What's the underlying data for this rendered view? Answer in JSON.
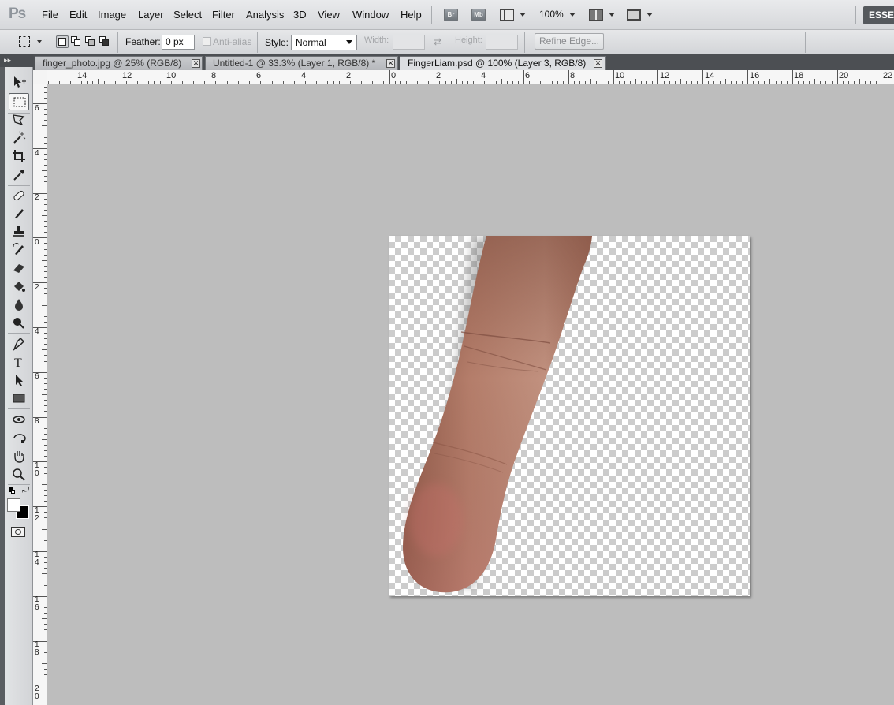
{
  "app": {
    "logo": "Ps",
    "workspace": "ESSENTIALS"
  },
  "menu": [
    "File",
    "Edit",
    "Image",
    "Layer",
    "Select",
    "Filter",
    "Analysis",
    "3D",
    "View",
    "Window",
    "Help"
  ],
  "appbar": {
    "bridge": "Br",
    "minibridge": "Mb",
    "zoom": "100%"
  },
  "options": {
    "feather_label": "Feather:",
    "feather_value": "0 px",
    "antialias_label": "Anti-alias",
    "style_label": "Style:",
    "style_value": "Normal",
    "width_label": "Width:",
    "height_label": "Height:",
    "refine_label": "Refine Edge..."
  },
  "tabs": [
    {
      "label": "finger_photo.jpg @ 25% (RGB/8)",
      "active": false
    },
    {
      "label": "Untitled-1 @ 33.3% (Layer 1, RGB/8) *",
      "active": false
    },
    {
      "label": "FingerLiam.psd @ 100% (Layer 3, RGB/8)",
      "active": true
    }
  ],
  "ruler_top": [
    "14",
    "12",
    "10",
    "8",
    "6",
    "4",
    "2",
    "0",
    "2",
    "4",
    "6",
    "8",
    "10",
    "12",
    "14",
    "16",
    "18",
    "20",
    "22"
  ],
  "ruler_left": [
    "6",
    "4",
    "2",
    "0",
    "2",
    "4",
    "6",
    "8",
    "10",
    "12",
    "14",
    "16",
    "18",
    "20"
  ],
  "tools": [
    "move",
    "rectangular-marquee",
    "polygonal-lasso",
    "magic-wand",
    "crop",
    "eyedropper",
    "spot-healing-brush",
    "brush",
    "clone-stamp",
    "history-brush",
    "eraser",
    "paint-bucket",
    "blur",
    "dodge",
    "pen",
    "type",
    "path-selection",
    "rectangle",
    "3d-rotate",
    "3d-orbit",
    "hand",
    "zoom"
  ],
  "colors": {
    "foreground": "#ffffff",
    "background": "#000000",
    "skin": "#b9806c"
  }
}
